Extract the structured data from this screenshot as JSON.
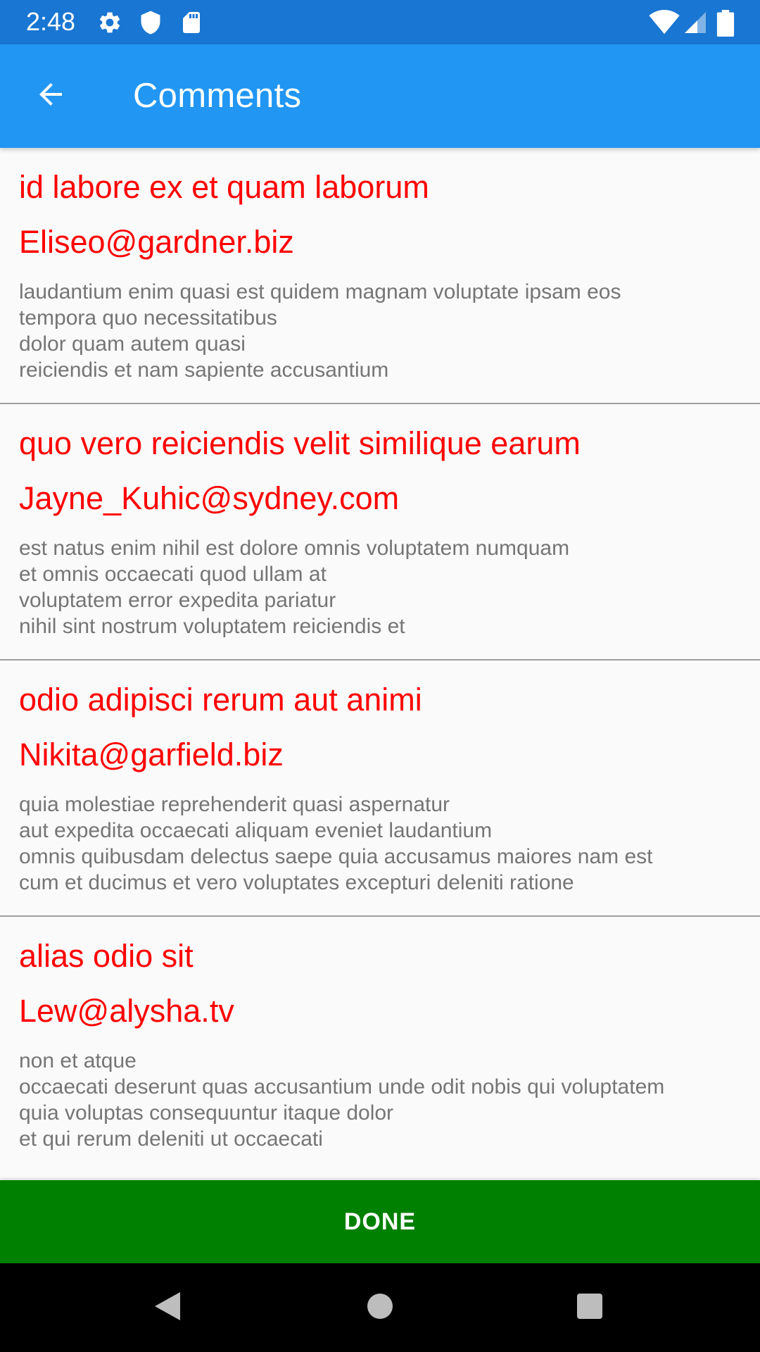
{
  "status_bar": {
    "time": "2:48",
    "icons": [
      "settings-icon",
      "shield-icon",
      "sd-card-icon",
      "wifi-icon",
      "cell-signal-icon",
      "battery-icon"
    ]
  },
  "app_bar": {
    "title": "Comments",
    "back_icon": "arrow-back-icon",
    "color": "#2196f3"
  },
  "comments": [
    {
      "name": "id labore ex et quam laborum",
      "email": "Eliseo@gardner.biz",
      "body_lines": [
        "laudantium enim quasi est quidem magnam voluptate ipsam eos",
        "tempora quo necessitatibus",
        "dolor quam autem quasi",
        "reiciendis et nam sapiente accusantium"
      ]
    },
    {
      "name": "quo vero reiciendis velit similique earum",
      "email": "Jayne_Kuhic@sydney.com",
      "body_lines": [
        "est natus enim nihil est dolore omnis voluptatem numquam",
        "et omnis occaecati quod ullam at",
        "voluptatem error expedita pariatur",
        "nihil sint nostrum voluptatem reiciendis et"
      ]
    },
    {
      "name": "odio adipisci rerum aut animi",
      "email": "Nikita@garfield.biz",
      "body_lines": [
        "quia molestiae reprehenderit quasi aspernatur",
        "aut expedita occaecati aliquam eveniet laudantium",
        "omnis quibusdam delectus saepe quia accusamus maiores nam est",
        "cum et ducimus et vero voluptates excepturi deleniti ratione"
      ]
    },
    {
      "name": "alias odio sit",
      "email": "Lew@alysha.tv",
      "body_lines": [
        "non et atque",
        "occaecati deserunt quas accusantium unde odit nobis qui voluptatem",
        "quia voluptas consequuntur itaque dolor",
        "et qui rerum deleniti ut occaecati"
      ]
    }
  ],
  "done_button": {
    "label": "DONE",
    "color": "#008000"
  },
  "nav_bar": {
    "icons": [
      "nav-back-icon",
      "nav-home-icon",
      "nav-recents-icon"
    ]
  },
  "colors": {
    "title_text": "#ff0000",
    "body_text": "#757575",
    "status_bar": "#1976d2"
  }
}
